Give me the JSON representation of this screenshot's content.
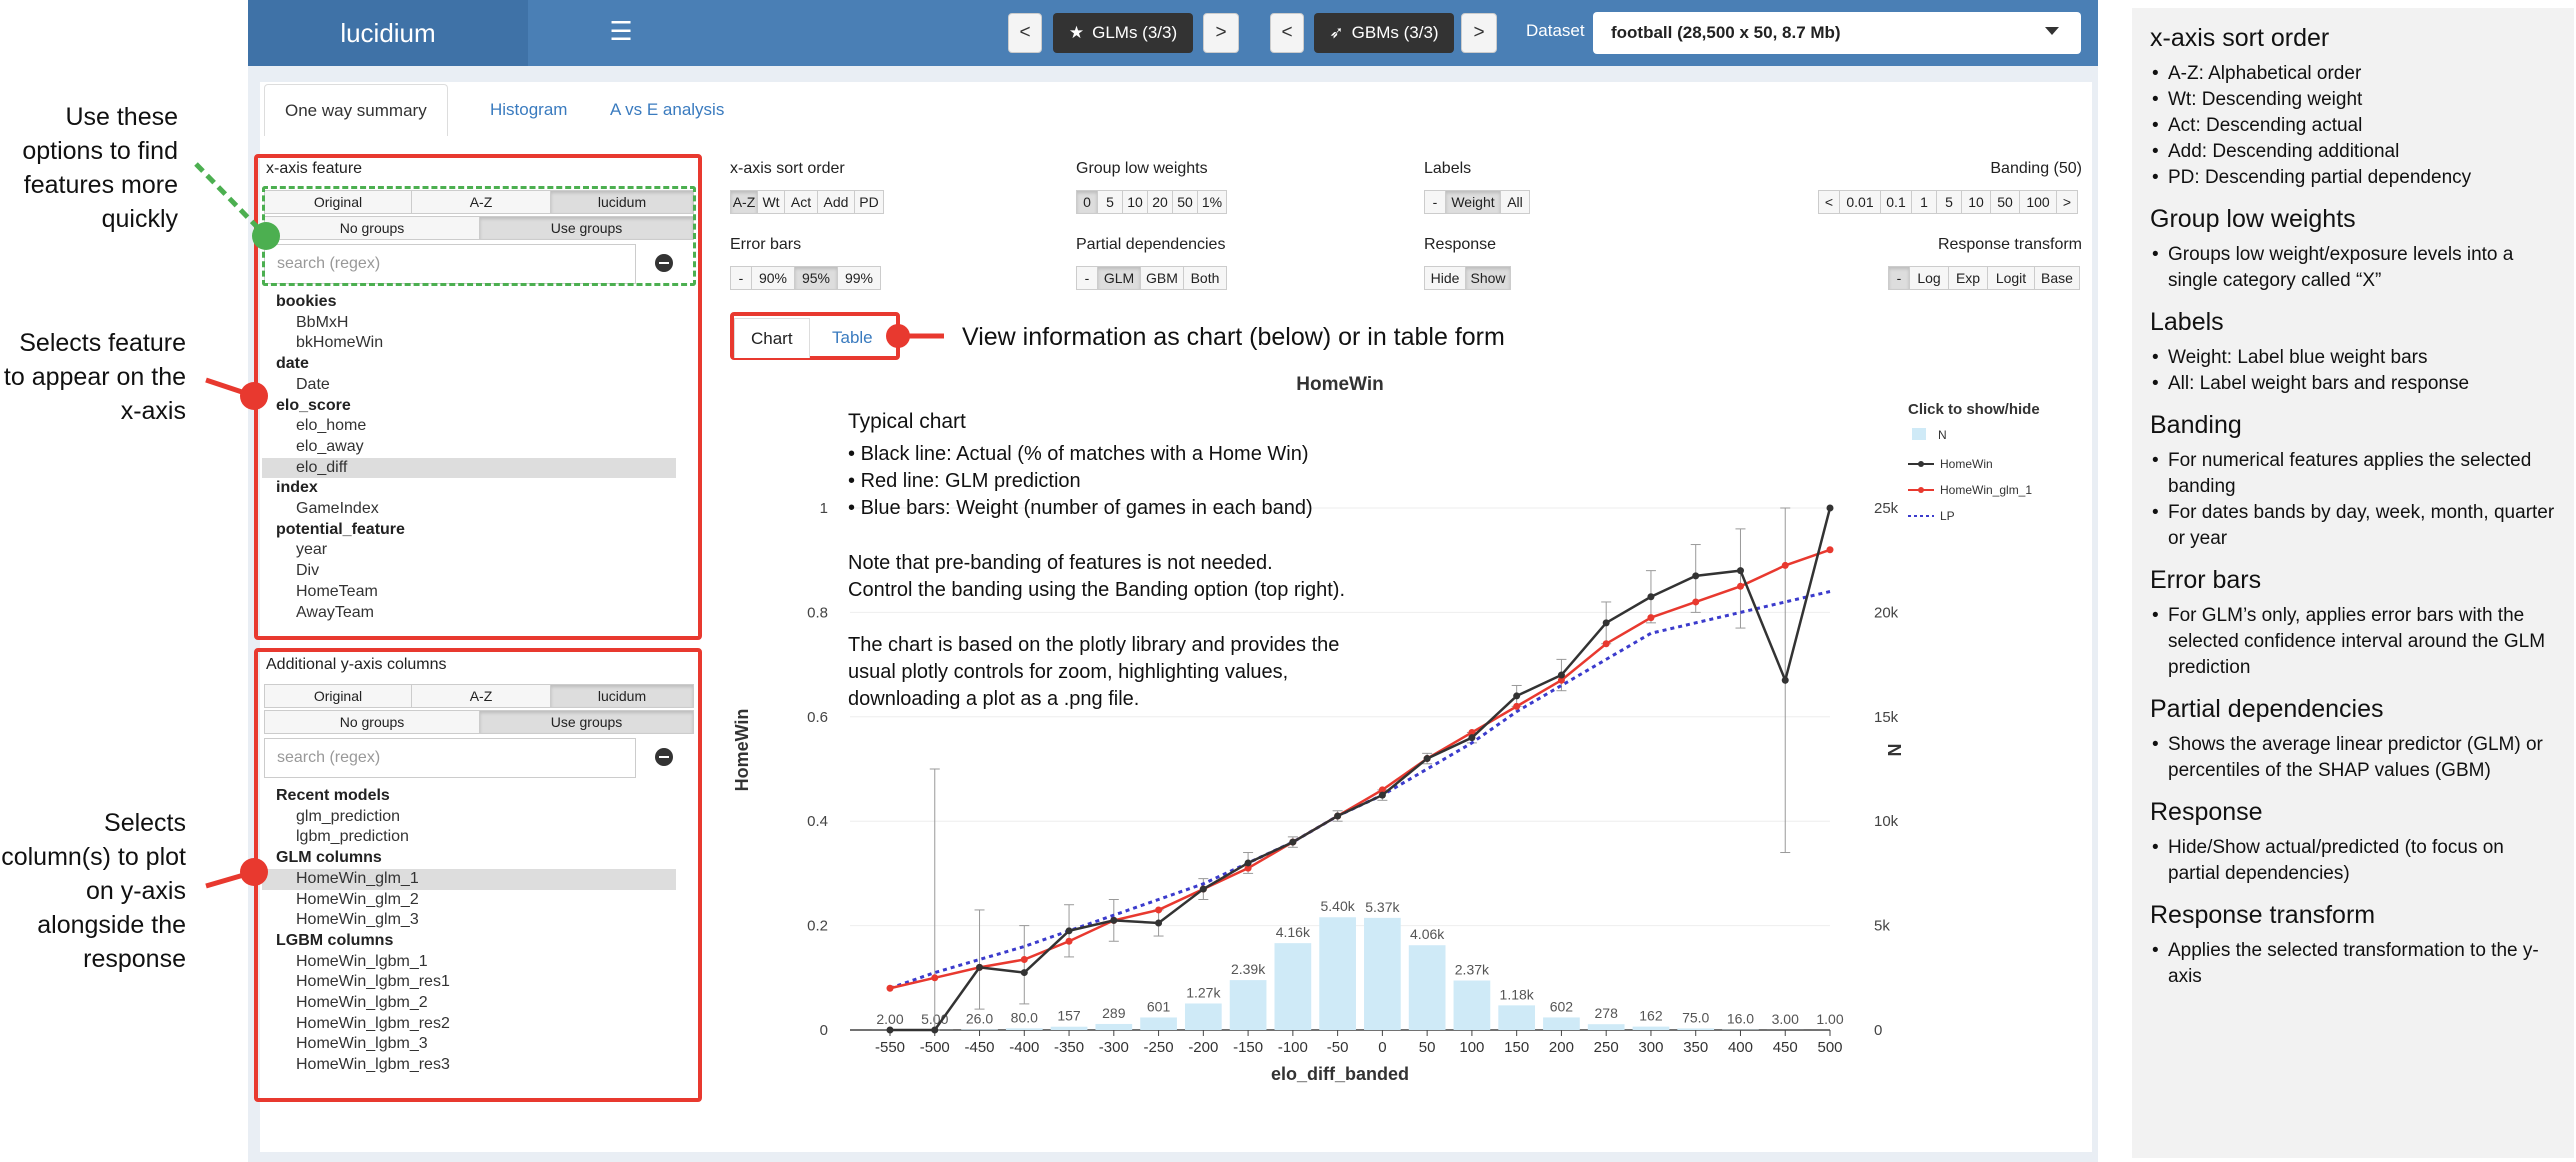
{
  "app": {
    "name": "lucidium",
    "menu_icon": "hamburger-icon"
  },
  "topbar": {
    "prev": "<",
    "next": ">",
    "glms": "GLMs (3/3)",
    "gbms": "GBMs (3/3)",
    "dataset_label": "Dataset",
    "dataset_value": "football (28,500 x 50, 8.7 Mb)"
  },
  "tabs": [
    "One way summary",
    "Histogram",
    "A vs E analysis"
  ],
  "xaxis_panel": {
    "title": "x-axis feature",
    "sort_options": [
      "Original",
      "A-Z",
      "lucidum"
    ],
    "group_options": [
      "No groups",
      "Use groups"
    ],
    "search_placeholder": "search (regex)",
    "groups": [
      {
        "name": "bookies",
        "items": [
          "BbMxH",
          "bkHomeWin"
        ]
      },
      {
        "name": "date",
        "items": [
          "Date"
        ]
      },
      {
        "name": "elo_score",
        "items": [
          "elo_home",
          "elo_away",
          "elo_diff"
        ]
      },
      {
        "name": "index",
        "items": [
          "GameIndex"
        ]
      },
      {
        "name": "potential_feature",
        "items": [
          "year",
          "Div",
          "HomeTeam",
          "AwayTeam"
        ]
      }
    ],
    "selected": "elo_diff"
  },
  "yaxis_panel": {
    "title": "Additional y-axis columns",
    "sort_options": [
      "Original",
      "A-Z",
      "lucidum"
    ],
    "group_options": [
      "No groups",
      "Use groups"
    ],
    "search_placeholder": "search (regex)",
    "groups": [
      {
        "name": "Recent models",
        "items": [
          "glm_prediction",
          "lgbm_prediction"
        ]
      },
      {
        "name": "GLM columns",
        "items": [
          "HomeWin_glm_1",
          "HomeWin_glm_2",
          "HomeWin_glm_3"
        ]
      },
      {
        "name": "LGBM columns",
        "items": [
          "HomeWin_lgbm_1",
          "HomeWin_lgbm_res1",
          "HomeWin_lgbm_2",
          "HomeWin_lgbm_res2",
          "HomeWin_lgbm_3",
          "HomeWin_lgbm_res3"
        ]
      }
    ],
    "selected": "HomeWin_glm_1"
  },
  "controls": {
    "sort": {
      "label": "x-axis sort order",
      "options": [
        "A-Z",
        "Wt",
        "Act",
        "Add",
        "PD"
      ],
      "selected": "A-Z"
    },
    "group_low": {
      "label": "Group low weights",
      "options": [
        "0",
        "5",
        "10",
        "20",
        "50",
        "1%"
      ],
      "selected": "0"
    },
    "labels": {
      "label": "Labels",
      "options": [
        "-",
        "Weight",
        "All"
      ],
      "selected": "Weight"
    },
    "banding": {
      "label": "Banding (50)",
      "options": [
        "<",
        "0.01",
        "0.1",
        "1",
        "5",
        "10",
        "50",
        "100",
        ">"
      ]
    },
    "error_bars": {
      "label": "Error bars",
      "options": [
        "-",
        "90%",
        "95%",
        "99%"
      ],
      "selected": "95%"
    },
    "partial": {
      "label": "Partial dependencies",
      "options": [
        "-",
        "GLM",
        "GBM",
        "Both"
      ],
      "selected": "GLM"
    },
    "response": {
      "label": "Response",
      "options": [
        "Hide",
        "Show"
      ],
      "selected": "Show"
    },
    "transform": {
      "label": "Response transform",
      "options": [
        "-",
        "Log",
        "Exp",
        "Logit",
        "Base"
      ],
      "selected": "-"
    }
  },
  "view_tabs": [
    "Chart",
    "Table"
  ],
  "annotations": {
    "find": "Use these options to find features more quickly",
    "feature": "Selects feature to appear on the x-axis",
    "columns": "Selects column(s) to plot on y-axis alongside the response",
    "view": "View information as chart (below) or in table form"
  },
  "chart_notes": {
    "heading": "Typical chart",
    "bullets": [
      "Black line: Actual (% of matches with a Home Win)",
      "Red line: GLM prediction",
      "Blue bars: Weight (number of games in each band)"
    ],
    "note1": [
      "Note that pre-banding of features is not needed.",
      "Control the banding using the Banding option (top right)."
    ],
    "note2": [
      "The chart is based on the plotly library and provides the",
      "usual plotly controls for zoom, highlighting values,",
      "downloading a plot as a .png file."
    ]
  },
  "chart_data": {
    "type": "line",
    "title": "HomeWin",
    "xlabel": "elo_diff_banded",
    "ylabel": "HomeWin",
    "y2label": "N",
    "categories": [
      "-550",
      "-500",
      "-450",
      "-400",
      "-350",
      "-300",
      "-250",
      "-200",
      "-150",
      "-100",
      "-50",
      "0",
      "50",
      "100",
      "150",
      "200",
      "250",
      "300",
      "350",
      "400",
      "450",
      "500"
    ],
    "ylim": [
      0,
      1.0
    ],
    "y_ticks": [
      "0",
      "0.2",
      "0.4",
      "0.6",
      "0.8",
      "1"
    ],
    "y2lim": [
      0,
      25000
    ],
    "y2_ticks": [
      "0",
      "5k",
      "10k",
      "15k",
      "20k",
      "25k"
    ],
    "bars": {
      "name": "N",
      "values": [
        2,
        5,
        26,
        80,
        157,
        289,
        601,
        1270,
        2390,
        4160,
        5400,
        5370,
        4060,
        2370,
        1180,
        602,
        278,
        162,
        75,
        16,
        3,
        1
      ],
      "labels": [
        "2.00",
        "5.00",
        "26.0",
        "80.0",
        "157",
        "289",
        "601",
        "1.27k",
        "2.39k",
        "4.16k",
        "5.40k",
        "5.37k",
        "4.06k",
        "2.37k",
        "1.18k",
        "602",
        "278",
        "162",
        "75.0",
        "16.0",
        "3.00",
        "1.00"
      ],
      "color": "#cfeaf7"
    },
    "series": [
      {
        "name": "HomeWin",
        "color": "#333333",
        "values": [
          0,
          0,
          0.12,
          0.11,
          0.19,
          0.21,
          0.205,
          0.27,
          0.32,
          0.36,
          0.41,
          0.45,
          0.52,
          0.56,
          0.64,
          0.68,
          0.78,
          0.83,
          0.87,
          0.88,
          0.67,
          1.0
        ],
        "error_low": [
          null,
          0,
          0.04,
          0.05,
          0.14,
          0.17,
          0.18,
          0.25,
          0.3,
          0.35,
          0.4,
          0.44,
          0.51,
          0.55,
          0.62,
          0.65,
          0.74,
          0.78,
          0.8,
          0.77,
          0.34,
          null
        ],
        "error_high": [
          null,
          0.5,
          0.23,
          0.2,
          0.24,
          0.25,
          0.23,
          0.29,
          0.34,
          0.37,
          0.42,
          0.46,
          0.53,
          0.57,
          0.66,
          0.71,
          0.82,
          0.88,
          0.93,
          0.96,
          1.0,
          null
        ]
      },
      {
        "name": "HomeWin_glm_1",
        "color": "#e8392f",
        "values": [
          0.08,
          0.1,
          0.12,
          0.135,
          0.17,
          0.21,
          0.23,
          0.27,
          0.31,
          0.36,
          0.41,
          0.46,
          0.52,
          0.57,
          0.62,
          0.67,
          0.74,
          0.79,
          0.82,
          0.85,
          0.89,
          0.92
        ]
      },
      {
        "name": "LP",
        "color": "#3b3bcc",
        "dash": true,
        "values": [
          0.08,
          0.11,
          0.135,
          0.16,
          0.19,
          0.22,
          0.25,
          0.28,
          0.32,
          0.36,
          0.41,
          0.45,
          0.5,
          0.55,
          0.61,
          0.66,
          0.71,
          0.76,
          0.78,
          0.8,
          0.82,
          0.84
        ]
      }
    ],
    "legend": {
      "title": "Click to show/hide",
      "position": "top-right"
    }
  },
  "help": [
    {
      "title": "x-axis sort order",
      "items": [
        "A-Z: Alphabetical order",
        "Wt: Descending weight",
        "Act: Descending actual",
        "Add: Descending additional",
        "PD: Descending partial dependency"
      ]
    },
    {
      "title": "Group low weights",
      "items": [
        "Groups low weight/exposure levels into a single category called “X”"
      ]
    },
    {
      "title": "Labels",
      "items": [
        "Weight: Label blue weight bars",
        "All: Label weight bars and response"
      ]
    },
    {
      "title": "Banding",
      "items": [
        "For numerical features applies the selected banding",
        "For dates bands by day, week, month, quarter or year"
      ]
    },
    {
      "title": "Error bars",
      "items": [
        "For GLM’s only, applies error bars with the selected confidence interval around the GLM prediction"
      ]
    },
    {
      "title": "Partial dependencies",
      "items": [
        "Shows the average linear predictor (GLM) or percentiles of the SHAP values (GBM)"
      ]
    },
    {
      "title": "Response",
      "items": [
        "Hide/Show actual/predicted (to focus on partial dependencies)"
      ]
    },
    {
      "title": "Response transform",
      "items": [
        "Applies the selected transformation to the y-axis"
      ]
    }
  ]
}
